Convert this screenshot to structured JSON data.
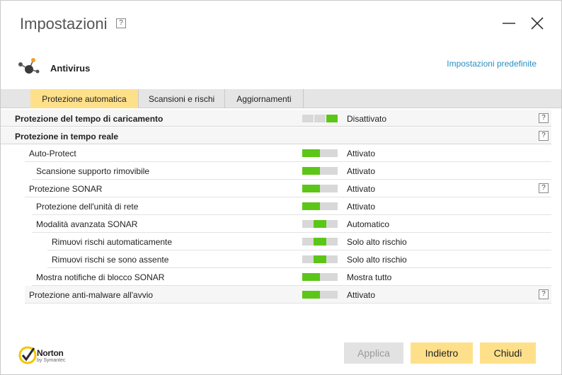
{
  "window": {
    "title": "Impostazioni",
    "help_label": "?"
  },
  "section": {
    "title": "Antivirus",
    "defaults_link": "Impostazioni predefinite"
  },
  "tabs": [
    {
      "label": "Protezione automatica",
      "active": true
    },
    {
      "label": "Scansioni e rischi",
      "active": false
    },
    {
      "label": "Aggiornamenti",
      "active": false
    }
  ],
  "rows": [
    {
      "label": "Protezione del tempo di caricamento",
      "value": "Disattivato",
      "toggle": "off",
      "help": "?"
    },
    {
      "label": "Protezione in tempo reale",
      "value": "",
      "toggle": "",
      "help": "?"
    },
    {
      "label": "Auto-Protect",
      "value": "Attivato",
      "toggle": "on",
      "help": ""
    },
    {
      "label": "Scansione supporto rimovibile",
      "value": "Attivato",
      "toggle": "on",
      "help": ""
    },
    {
      "label": "Protezione SONAR",
      "value": "Attivato",
      "toggle": "on",
      "help": "?"
    },
    {
      "label": "Protezione dell'unità di rete",
      "value": "Attivato",
      "toggle": "on",
      "help": ""
    },
    {
      "label": "Modalità avanzata SONAR",
      "value": "Automatico",
      "toggle": "mid",
      "help": ""
    },
    {
      "label": "Rimuovi rischi automaticamente",
      "value": "Solo alto rischio",
      "toggle": "mid",
      "help": ""
    },
    {
      "label": "Rimuovi rischi se sono assente",
      "value": "Solo alto rischio",
      "toggle": "mid",
      "help": ""
    },
    {
      "label": "Mostra notifiche di blocco SONAR",
      "value": "Mostra tutto",
      "toggle": "on",
      "help": ""
    },
    {
      "label": "Protezione anti-malware all'avvio",
      "value": "Attivato",
      "toggle": "on",
      "help": "?"
    }
  ],
  "footer": {
    "brand": "Norton",
    "brand_sub": "by Symantec",
    "apply_label": "Applica",
    "back_label": "Indietro",
    "close_label": "Chiudi"
  },
  "colors": {
    "accent_yellow": "#ffe08a",
    "toggle_green": "#5bc617",
    "link_blue": "#2a8ec0"
  }
}
